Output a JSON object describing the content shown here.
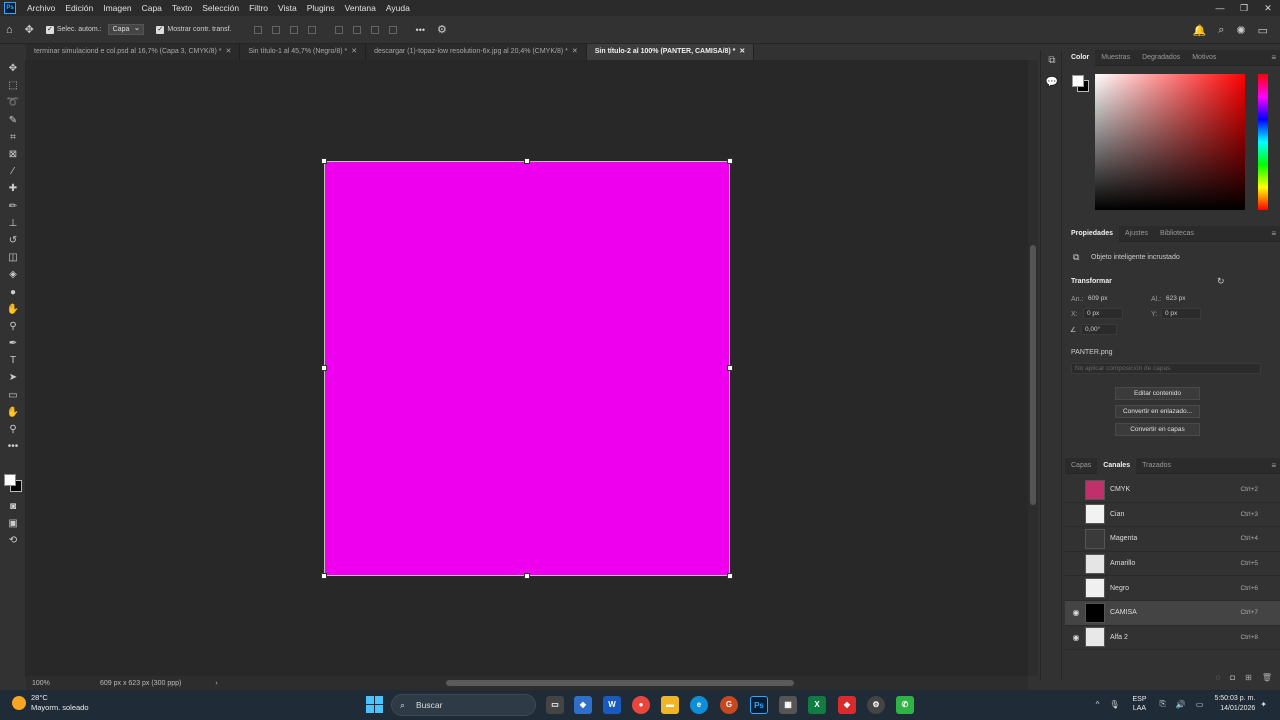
{
  "menu": [
    "Archivo",
    "Edición",
    "Imagen",
    "Capa",
    "Texto",
    "Selección",
    "Filtro",
    "Vista",
    "Plugins",
    "Ventana",
    "Ayuda"
  ],
  "options": {
    "autoselect_label": "Selec. autom.:",
    "autoselect_value": "Capa",
    "show_transform_label": "Mostrar contr. transf.",
    "more": "•••"
  },
  "tabs": [
    {
      "label": "terminar simulaciond e col.psd al 16,7% (Capa 3, CMYK/8) *",
      "active": false
    },
    {
      "label": "Sin título-1 al 45,7% (Negro/8) *",
      "active": false
    },
    {
      "label": "descargar (1)-topaz-low resolution-6x.jpg al 20,4% (CMYK/8) *",
      "active": false
    },
    {
      "label": "Sin título-2 al 100% (PANTER, CAMISA/8) *",
      "active": true
    }
  ],
  "canvas": {
    "fill_color": "#ee00ee"
  },
  "status": {
    "zoom": "100%",
    "dimensions": "609 px x 623 px (300 ppp)",
    "arrow": "›"
  },
  "color_panel": {
    "tabs": [
      "Color",
      "Muestras",
      "Degradados",
      "Motivos"
    ]
  },
  "properties": {
    "tabs": [
      "Propiedades",
      "Ajustes",
      "Bibliotecas"
    ],
    "object_type": "Objeto inteligente incrustado",
    "section": "Transformar",
    "width_label": "An.:",
    "width": "609 px",
    "height_label": "Al.:",
    "height": "623 px",
    "x_label": "X:",
    "x": "0 px",
    "y_label": "Y:",
    "y": "0 px",
    "angle": "0,00°",
    "file": "PANTER.png",
    "comp_placeholder": "No aplicar composición de capas",
    "buttons": [
      "Editar contenido",
      "Convertir en enlazado...",
      "Convertir en capas"
    ]
  },
  "channels": {
    "tabs": [
      "Capas",
      "Canales",
      "Trazados"
    ],
    "rows": [
      {
        "name": "CMYK",
        "shortcut": "Ctrl+2",
        "visible": false,
        "selected": false
      },
      {
        "name": "Cian",
        "shortcut": "Ctrl+3",
        "visible": false,
        "selected": false
      },
      {
        "name": "Magenta",
        "shortcut": "Ctrl+4",
        "visible": false,
        "selected": false
      },
      {
        "name": "Amarillo",
        "shortcut": "Ctrl+5",
        "visible": false,
        "selected": false
      },
      {
        "name": "Negro",
        "shortcut": "Ctrl+6",
        "visible": false,
        "selected": false
      },
      {
        "name": "CAMISA",
        "shortcut": "Ctrl+7",
        "visible": true,
        "selected": true
      },
      {
        "name": "Alfa 2",
        "shortcut": "Ctrl+8",
        "visible": true,
        "selected": false
      }
    ]
  },
  "taskbar": {
    "temperature": "28°C",
    "weather": "Mayorm. soleado",
    "search": "Buscar",
    "lang1": "ESP",
    "lang2": "LAA",
    "time": "5:50:03 p. m.",
    "date": "14/01/2026"
  }
}
